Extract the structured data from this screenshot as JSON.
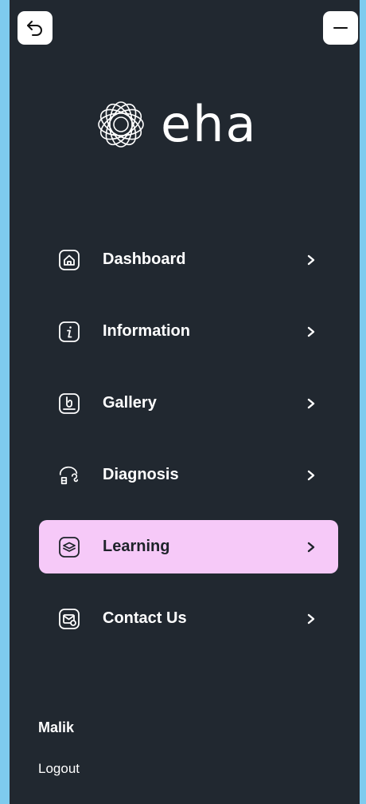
{
  "brand": {
    "name": "eha",
    "logo_icon": "intertwined-rings-icon"
  },
  "header": {
    "back_icon": "undo-arrow-icon",
    "minimize_icon": "minus-icon"
  },
  "menu": {
    "items": [
      {
        "label": "Dashboard",
        "icon": "home-icon",
        "active": false
      },
      {
        "label": "Information",
        "icon": "info-icon",
        "active": false
      },
      {
        "label": "Gallery",
        "icon": "gallery-icon",
        "active": false
      },
      {
        "label": "Diagnosis",
        "icon": "diagnosis-icon",
        "active": false
      },
      {
        "label": "Learning",
        "icon": "learning-icon",
        "active": true
      },
      {
        "label": "Contact Us",
        "icon": "contact-icon",
        "active": false
      }
    ]
  },
  "user": {
    "name": "Malik",
    "logout_label": "Logout"
  },
  "colors": {
    "background": "#7ecbee",
    "panel": "#212830",
    "active_item": "#f6c9f8",
    "text": "#ffffff"
  }
}
